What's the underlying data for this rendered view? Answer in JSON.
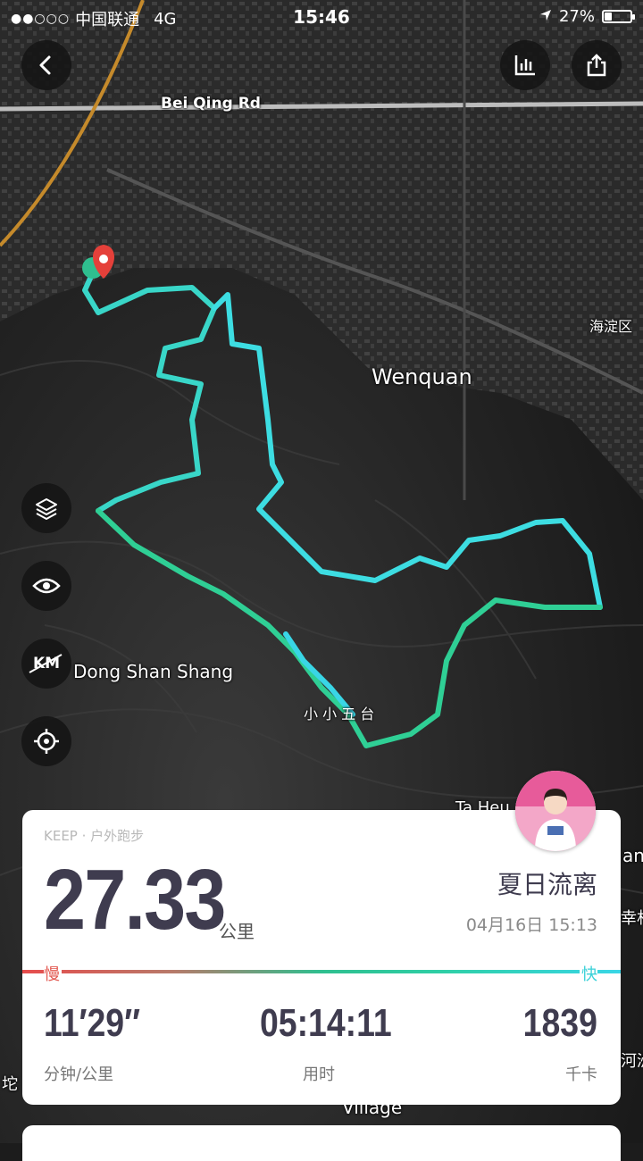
{
  "status_bar": {
    "carrier": "中国联通",
    "network": "4G",
    "time": "15:46",
    "battery": "27%",
    "battery_level": 0.27
  },
  "map": {
    "labels": {
      "road": "Bei Qing Rd",
      "district": "海淀区",
      "area": "Wenquan",
      "place1": "Dong Shan Shang",
      "place2": "小 小 五 台",
      "place3": "Ta Heu",
      "place4": "Village",
      "edge1": "any",
      "edge2": "幸村",
      "edge3": "河洲",
      "edge4": "坨"
    },
    "km_toggle": "KM",
    "route_colors": {
      "slow": "#e74c4c",
      "mid": "#2fbf8f",
      "fast": "#39d6e6"
    },
    "pin_color": "#e5403a"
  },
  "icons": {
    "back": "chevron-left-icon",
    "stats": "bar-chart-icon",
    "share": "share-icon",
    "layers": "layers-icon",
    "eye": "eye-icon",
    "km": "km-icon",
    "locate": "locate-icon"
  },
  "card": {
    "brand": "KEEP · 户外跑步",
    "distance": "27.33",
    "distance_unit": "公里",
    "user_name": "夏日流离",
    "date": "04月16日 15:13",
    "slow_label": "慢",
    "fast_label": "快",
    "stats": [
      {
        "value": "11′29″",
        "label": "分钟/公里"
      },
      {
        "value": "05:14:11",
        "label": "用时"
      },
      {
        "value": "1839",
        "label": "千卡"
      }
    ]
  }
}
